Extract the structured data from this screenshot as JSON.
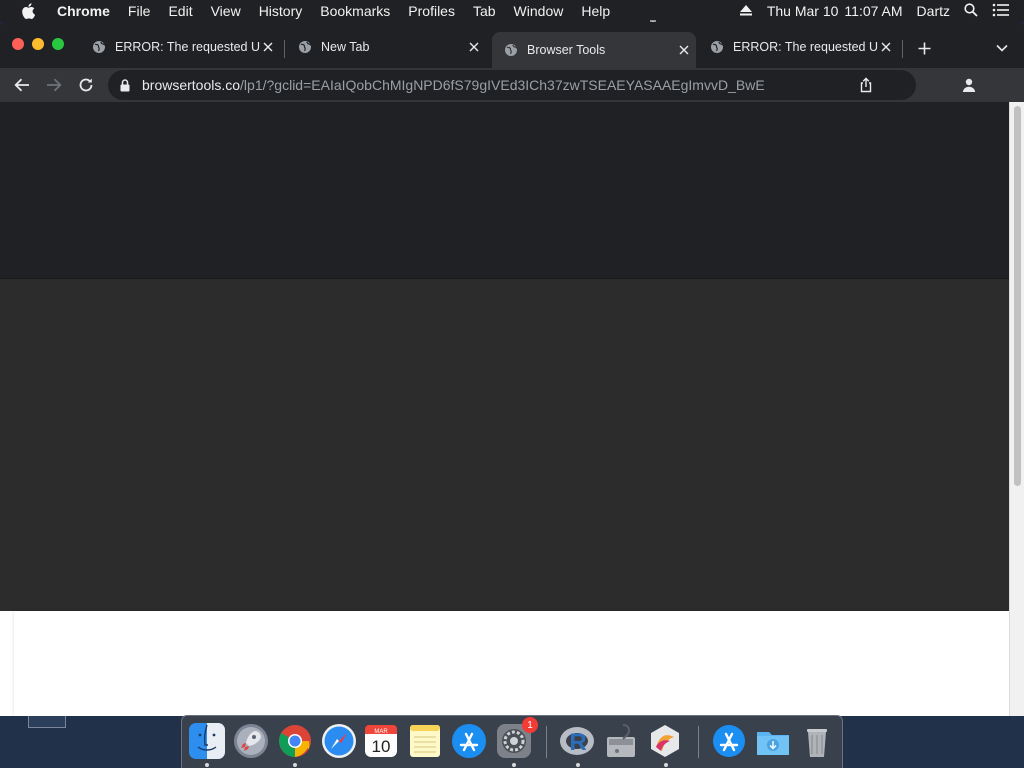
{
  "menubar": {
    "app": "Chrome",
    "items": [
      "File",
      "Edit",
      "View",
      "History",
      "Bookmarks",
      "Profiles",
      "Tab",
      "Window",
      "Help"
    ],
    "date": "Thu Mar 10",
    "time": "11:07 AM",
    "user": "Dartz"
  },
  "tabs": [
    {
      "title": "ERROR: The requested U",
      "active": false
    },
    {
      "title": "New Tab",
      "active": false
    },
    {
      "title": "Browser Tools",
      "active": true
    },
    {
      "title": "ERROR: The requested U",
      "active": false
    }
  ],
  "omnibox": {
    "host": "browsertools.co",
    "path": "/lp1/?gclid=EAIaIQobChMIgNPD6fS79gIVEd3ICh37zwTSEAEYASAAEgImvvD_BwE"
  },
  "dock": {
    "icons": [
      {
        "name": "finder-icon",
        "running": true
      },
      {
        "name": "launchpad-icon",
        "running": false
      },
      {
        "name": "chrome-icon",
        "running": true
      },
      {
        "name": "safari-icon",
        "running": false
      },
      {
        "name": "calendar-icon",
        "running": false,
        "month": "MAR",
        "day": "10"
      },
      {
        "name": "notes-icon",
        "running": false
      },
      {
        "name": "app-store-icon",
        "running": false
      },
      {
        "name": "system-preferences-icon",
        "running": true,
        "badge": "1"
      },
      {
        "name": "r-app-icon",
        "running": true
      },
      {
        "name": "disk-utility-icon",
        "running": false
      },
      {
        "name": "grapher-icon",
        "running": true
      },
      {
        "name": "app-store-folder-icon",
        "running": false
      },
      {
        "name": "downloads-folder-icon",
        "running": false
      },
      {
        "name": "trash-icon",
        "running": false
      }
    ]
  },
  "colors": {
    "titlebar": "#202124",
    "toolbar": "#35363a",
    "band_dark": "#202124",
    "band_mid": "#2c2c2c",
    "page_bg": "#ffffff"
  }
}
